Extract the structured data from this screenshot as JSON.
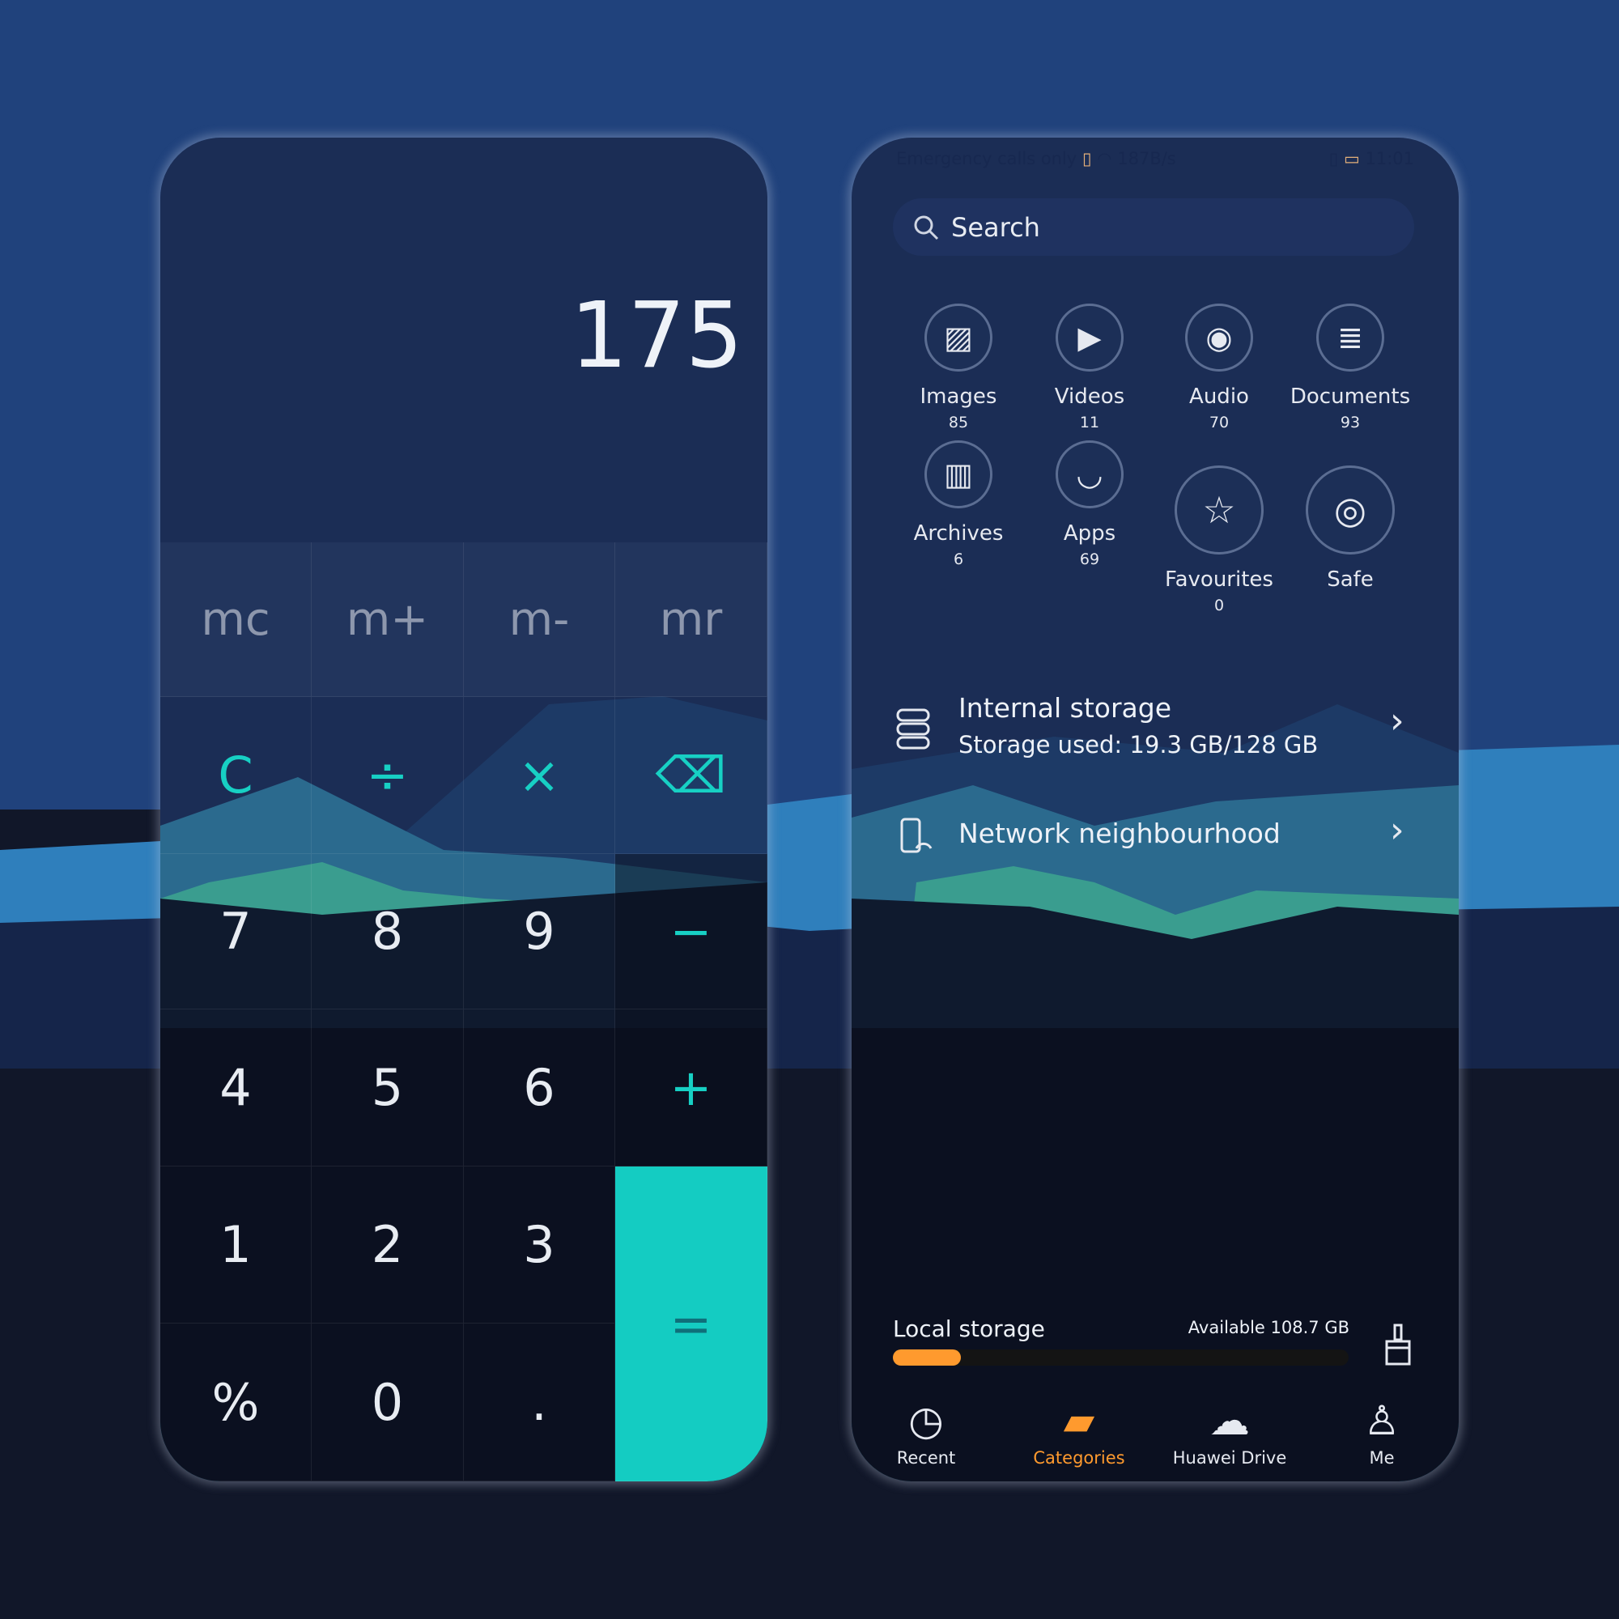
{
  "colors": {
    "accent": "#17d0c4",
    "orange": "#ff9a2e",
    "bg": "#1e3f7a"
  },
  "calculator": {
    "display": "175",
    "memory_keys": [
      "mc",
      "m+",
      "m-",
      "mr"
    ],
    "rows": [
      [
        "C",
        "÷",
        "×",
        "⌫"
      ],
      [
        "7",
        "8",
        "9",
        "−"
      ],
      [
        "4",
        "5",
        "6",
        "+"
      ],
      [
        "1",
        "2",
        "3",
        "="
      ],
      [
        "%",
        "0",
        "."
      ]
    ]
  },
  "files": {
    "status_bar": {
      "carrier": "Emergency calls only",
      "speed": "187B/s",
      "time": "11:01"
    },
    "search": {
      "placeholder": "Search"
    },
    "categories": [
      {
        "label": "Images",
        "count": "85",
        "icon": "image-icon"
      },
      {
        "label": "Videos",
        "count": "11",
        "icon": "video-icon"
      },
      {
        "label": "Audio",
        "count": "70",
        "icon": "audio-icon"
      },
      {
        "label": "Documents",
        "count": "93",
        "icon": "document-icon"
      },
      {
        "label": "Archives",
        "count": "6",
        "icon": "archive-icon"
      },
      {
        "label": "Apps",
        "count": "69",
        "icon": "apps-icon"
      },
      {
        "label": "Favourites",
        "count": "0",
        "icon": "star-folder-icon"
      },
      {
        "label": "Safe",
        "count": "",
        "icon": "safe-icon"
      }
    ],
    "internal_storage": {
      "title": "Internal storage",
      "subtitle": "Storage used: 19.3 GB/128 GB"
    },
    "network": {
      "title": "Network neighbourhood"
    },
    "local_storage": {
      "label": "Local storage",
      "available": "Available 108.7 GB",
      "used_percent": 15
    },
    "nav": [
      {
        "label": "Recent",
        "icon": "clock-icon"
      },
      {
        "label": "Categories",
        "icon": "folder-icon",
        "active": true
      },
      {
        "label": "Huawei Drive",
        "icon": "cloud-icon"
      },
      {
        "label": "Me",
        "icon": "person-icon"
      }
    ]
  }
}
